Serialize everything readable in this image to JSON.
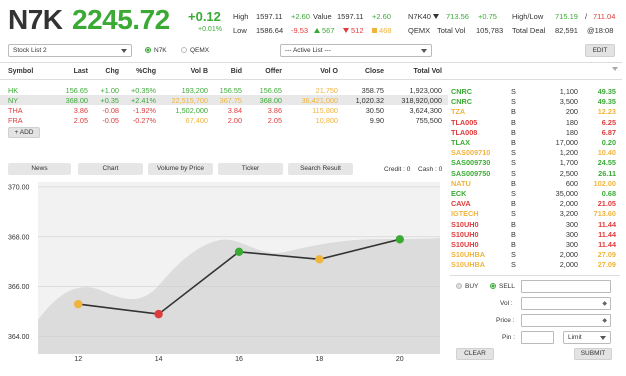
{
  "header": {
    "symbol": "N7K",
    "price": "2245.72",
    "change": "+0.12",
    "change_pct": "+0.01%",
    "high_label": "High",
    "high_value": "1597.11",
    "high_change": "+2.60",
    "low_label": "Low",
    "low_value": "1586.64",
    "low_change": "-9.53",
    "value_label": "Value",
    "value_value": "1597.11",
    "value_change": "+2.60",
    "adv": "567",
    "dec": "512",
    "unch": "468",
    "index_select": "N7K40",
    "index_value": "713.56",
    "index_change": "+0.75",
    "hl_label": "High/Low",
    "hl_high": "715.19",
    "hl_sep": "/",
    "hl_low": "711.04",
    "qemx_label": "QEMX",
    "total_vol_label": "Total Vol",
    "total_vol": "105,783",
    "total_deal_label": "Total Deal",
    "total_deal": "82,591",
    "time": "@18:08"
  },
  "controls": {
    "stock_list": "Stock List 2",
    "radio1": "N7K",
    "radio2": "QEMX",
    "active_list": "--- Active List ---",
    "edit": "EDIT"
  },
  "table": {
    "headers": [
      "Symbol",
      "Last",
      "Chg",
      "%Chg",
      "Vol B",
      "Bid",
      "Offer",
      "Vol O",
      "Close",
      "Total Vol"
    ],
    "rows": [
      {
        "symbol": "HK",
        "last": "156.65",
        "chg": "+1.00",
        "pct": "+0.35%",
        "volb": "193,200",
        "bid": "156.55",
        "offer": "156.65",
        "volo": "21,750",
        "close": "358.75",
        "total": "1,923,000"
      },
      {
        "symbol": "NY",
        "last": "368.00",
        "chg": "+0.35",
        "pct": "+2.41%",
        "volb": "22,515,700",
        "bid": "367.75",
        "offer": "368.00",
        "volo": "36,421,000",
        "close": "1,020.32",
        "total": "318,920,000"
      },
      {
        "symbol": "THA",
        "last": "3.86",
        "chg": "-0.08",
        "pct": "-1.92%",
        "volb": "1,502,000",
        "bid": "3.84",
        "offer": "3.86",
        "volo": "115,800",
        "close": "30.50",
        "total": "3,624,300"
      },
      {
        "symbol": "FRA",
        "last": "2.05",
        "chg": "-0.05",
        "pct": "-0.27%",
        "volb": "67,400",
        "bid": "2.00",
        "offer": "2.05",
        "volo": "10,800",
        "close": "9.90",
        "total": "755,500"
      }
    ],
    "add_label": "+ ADD"
  },
  "tabs": {
    "news": "News",
    "chart": "Chart",
    "volume_by_price": "Volume by Price",
    "ticker": "Ticker",
    "search_result": "Search Result",
    "credit_label": "Credit :",
    "credit_value": "0",
    "cash_label": "Cash :",
    "cash_value": "0"
  },
  "chart_data": {
    "type": "line",
    "x": [
      12,
      14,
      16,
      18,
      20
    ],
    "series": [
      {
        "values": [
          365.3,
          364.9,
          367.4,
          367.1,
          367.9
        ]
      }
    ],
    "point_colors": [
      "#f0b43c",
      "#e03b3b",
      "#3aaa35",
      "#f0b43c",
      "#3aaa35"
    ],
    "yticks": [
      "370.00",
      "368.00",
      "366.00",
      "364.00"
    ],
    "xticks": [
      "12",
      "14",
      "16",
      "18",
      "20"
    ],
    "ylim": [
      363.3,
      370.2
    ],
    "xlim": [
      11,
      21
    ],
    "line_color": "#333333",
    "area_color": "#dddddd"
  },
  "right_list": [
    {
      "symbol": "CNRC",
      "side": "S",
      "vol": "1,100",
      "price": "49.35",
      "color": "#3aaa35"
    },
    {
      "symbol": "CNRC",
      "side": "S",
      "vol": "3,500",
      "price": "49.35",
      "color": "#3aaa35"
    },
    {
      "symbol": "TZA",
      "side": "B",
      "vol": "200",
      "price": "12.23",
      "color": "#f0b43c"
    },
    {
      "symbol": "TLA005",
      "side": "B",
      "vol": "180",
      "price": "6.25",
      "color": "#e03b3b"
    },
    {
      "symbol": "TLA008",
      "side": "B",
      "vol": "180",
      "price": "6.87",
      "color": "#e03b3b"
    },
    {
      "symbol": "TLAX",
      "side": "B",
      "vol": "17,000",
      "price": "0.20",
      "color": "#3aaa35"
    },
    {
      "symbol": "SAS009710",
      "side": "S",
      "vol": "1,200",
      "price": "10.40",
      "color": "#f0b43c"
    },
    {
      "symbol": "SAS009730",
      "side": "S",
      "vol": "1,700",
      "price": "24.55",
      "color": "#3aaa35"
    },
    {
      "symbol": "SAS009750",
      "side": "S",
      "vol": "2,500",
      "price": "26.11",
      "color": "#3aaa35"
    },
    {
      "symbol": "NATU",
      "side": "B",
      "vol": "600",
      "price": "102.00",
      "color": "#f0b43c"
    },
    {
      "symbol": "ECK",
      "side": "S",
      "vol": "35,000",
      "price": "0.68",
      "color": "#3aaa35"
    },
    {
      "symbol": "CAVA",
      "side": "B",
      "vol": "2,000",
      "price": "21.05",
      "color": "#e03b3b"
    },
    {
      "symbol": "IGTECH",
      "side": "S",
      "vol": "3,200",
      "price": "713.60",
      "color": "#f0b43c"
    },
    {
      "symbol": "S10UH0",
      "side": "B",
      "vol": "300",
      "price": "11.44",
      "color": "#e03b3b"
    },
    {
      "symbol": "S10UH0",
      "side": "B",
      "vol": "300",
      "price": "11.44",
      "color": "#e03b3b"
    },
    {
      "symbol": "S10UH0",
      "side": "B",
      "vol": "300",
      "price": "11.44",
      "color": "#e03b3b"
    },
    {
      "symbol": "S10UHBA",
      "side": "S",
      "vol": "2,000",
      "price": "27.09",
      "color": "#f0b43c"
    },
    {
      "symbol": "S10UHBA",
      "side": "S",
      "vol": "2,000",
      "price": "27.09",
      "color": "#f0b43c"
    }
  ],
  "order": {
    "buy": "BUY",
    "sell": "SELL",
    "vol_label": "Vol :",
    "price_label": "Price :",
    "pin_label": "Pin :",
    "limit": "Limit",
    "clear": "CLEAR",
    "submit": "SUBMIT"
  },
  "colors": {
    "up": "#3aaa35",
    "down": "#e03b3b",
    "unchanged": "#f0b43c"
  }
}
